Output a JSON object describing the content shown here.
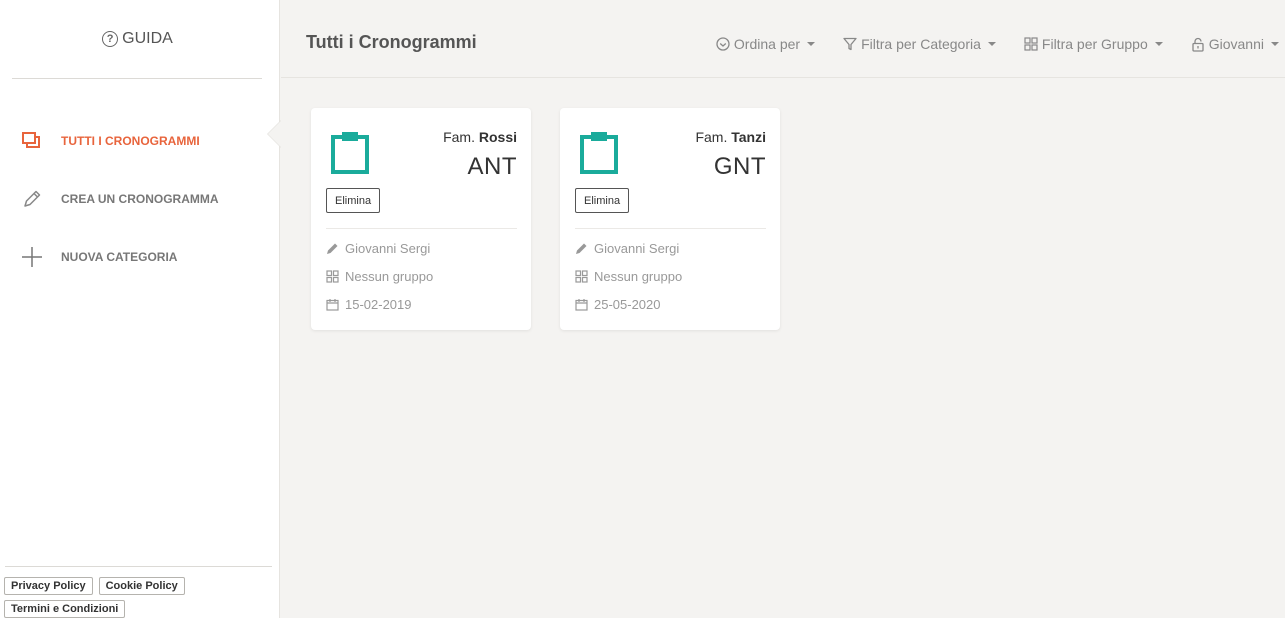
{
  "sidebar": {
    "guida_label": "GUIDA",
    "nav": [
      {
        "label": "TUTTI I CRONOGRAMMI",
        "icon": "stacked-squares-icon",
        "active": true
      },
      {
        "label": "CREA UN CRONOGRAMMA",
        "icon": "pencil-icon",
        "active": false
      },
      {
        "label": "NUOVA CATEGORIA",
        "icon": "plus-icon",
        "active": false
      }
    ],
    "footer_links": [
      "Privacy Policy",
      "Cookie Policy",
      "Termini e Condizioni"
    ]
  },
  "header": {
    "title": "Tutti i Cronogrammi",
    "tools": [
      {
        "label": "Ordina per",
        "icon": "circle-check-icon"
      },
      {
        "label": "Filtra per Categoria",
        "icon": "filter-icon"
      },
      {
        "label": "Filtra per Gruppo",
        "icon": "grid-icon"
      },
      {
        "label": "Giovanni",
        "icon": "lock-icon"
      }
    ]
  },
  "cards": [
    {
      "family_prefix": "Fam.",
      "family_name": "Rossi",
      "code": "ANT",
      "delete_label": "Elimina",
      "author": "Giovanni Sergi",
      "group": "Nessun gruppo",
      "date": "15-02-2019"
    },
    {
      "family_prefix": "Fam.",
      "family_name": "Tanzi",
      "code": "GNT",
      "delete_label": "Elimina",
      "author": "Giovanni Sergi",
      "group": "Nessun gruppo",
      "date": "25-05-2020"
    }
  ],
  "colors": {
    "accent": "#e8643c",
    "card_icon": "#1aab9b",
    "muted_text": "#999999"
  }
}
